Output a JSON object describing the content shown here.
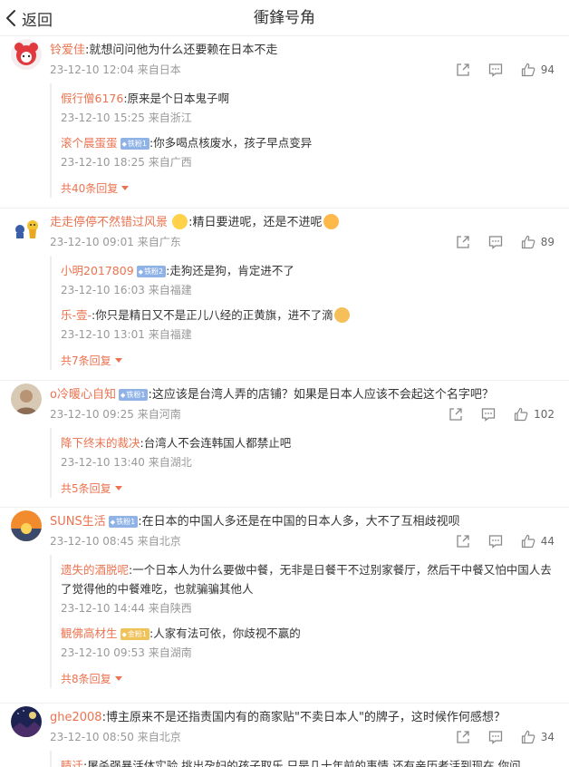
{
  "header": {
    "back_label": "返回",
    "title": "衝鋒号角"
  },
  "colors": {
    "username": "#eb7350",
    "meta": "#999999",
    "badge_blue": "#8fb3e6",
    "badge_gold": "#f0c25a"
  },
  "comments": [
    {
      "avatar_icon": "red-cartoon-avatar",
      "user": "铃爱佳",
      "text": ":就想问问他为什么还要赖在日本不走",
      "time": "23-12-10 12:04",
      "source": "来自日本",
      "likes": "94",
      "replies": [
        {
          "user": "假行僧6176",
          "text": ":原来是个日本鬼子啊",
          "time": "23-12-10 15:25",
          "source": "来自浙江"
        },
        {
          "user": "滚个晨蛋蛋",
          "badge": "铁粉1",
          "text": ":你多喝点核废水，孩子早点变异",
          "time": "23-12-10 18:25",
          "source": "来自广西"
        }
      ],
      "more": "共40条回复"
    },
    {
      "avatar_icon": "cartoon-figures-avatar",
      "user": "走走停停不然错过风景",
      "text": ":精日要进呢，还是不进呢",
      "time": "23-12-10 09:01",
      "source": "来自广东",
      "likes": "89",
      "replies": [
        {
          "user": "小明2017809",
          "badge": "铁粉2",
          "text": ":走狗还是狗，肯定进不了",
          "time": "23-12-10 16:03",
          "source": "来自福建"
        },
        {
          "user": "乐-壹-",
          "text": ":你只是精日又不是正儿八经的正黄旗，进不了滴",
          "time": "23-12-10 13:01",
          "source": "来自福建"
        }
      ],
      "more": "共7条回复"
    },
    {
      "avatar_icon": "portrait-avatar",
      "user": "o冷暖心自知",
      "badge": "铁粉1",
      "text": ":这应该是台湾人弄的店铺？如果是日本人应该不会起这个名字吧？",
      "time": "23-12-10 09:25",
      "source": "来自河南",
      "likes": "102",
      "replies": [
        {
          "user": "降下终末的裁决",
          "text": ":台湾人不会连韩国人都禁止吧",
          "time": "23-12-10 13:40",
          "source": "来自湖北"
        }
      ],
      "more": "共5条回复"
    },
    {
      "avatar_icon": "sunset-avatar",
      "user": "SUNS生活",
      "badge": "铁粉1",
      "text": ":在日本的中国人多还是在中国的日本人多，大不了互相歧视呗",
      "time": "23-12-10 08:45",
      "source": "来自北京",
      "likes": "44",
      "replies": [
        {
          "user": "遗失的酒脱呢",
          "text": ":一个日本人为什么要做中餐，无非是日餐干不过别家餐厅，然后干中餐又怕中国人去了觉得他的中餐难吃，也就骗骗其他人",
          "time": "23-12-10 14:44",
          "source": "来自陕西"
        },
        {
          "user": "観佛高材生",
          "badge": "金粉1",
          "badge_style": "gold",
          "text": ":人家有法可依，你歧视不赢的",
          "time": "23-12-10 09:53",
          "source": "来自湖南"
        }
      ],
      "more": "共8条回复"
    },
    {
      "avatar_icon": "night-sky-avatar",
      "user": "ghe2008",
      "text": ":博主原来不是还指责国内有的商家贴\"不卖日本人\"的牌子，这时候作何感想？",
      "time": "23-12-10 08:50",
      "source": "来自北京",
      "likes": "34",
      "replies": [
        {
          "user": "睛迁",
          "text": ":屠杀强暴活体实验  挑出孕妇的孩子取乐  只是几十年前的事情  还有亲历者活到现在  你问",
          "time": "",
          "source": ""
        }
      ],
      "more": ""
    }
  ]
}
